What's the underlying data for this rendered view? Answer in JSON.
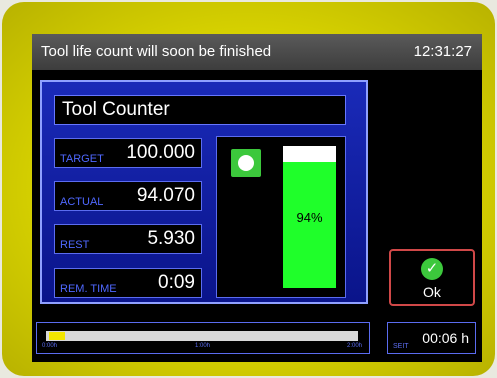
{
  "header": {
    "title": "Tool life count will soon be finished",
    "clock": "12:31:27"
  },
  "panel": {
    "title": "Tool Counter",
    "fields": [
      {
        "label": "TARGET",
        "value": "100.000"
      },
      {
        "label": "ACTUAL",
        "value": "94.070"
      },
      {
        "label": "REST",
        "value": "5.930"
      },
      {
        "label": "REM. TIME",
        "value": "0:09"
      }
    ],
    "gauge": {
      "percent_label": "94%",
      "fraction": 0.94,
      "icon": "tool-counter-icon"
    }
  },
  "ok_button": {
    "label": "Ok",
    "icon": "checkmark-icon"
  },
  "timeline": {
    "ticks": [
      "0:00h",
      "1:00h",
      "2:00h"
    ],
    "progress_fraction": 0.05
  },
  "seit": {
    "label": "SEIT",
    "value": "00:06 h"
  },
  "colors": {
    "bezel": "#e0dc00",
    "panel": "#1422a8",
    "gauge_fill": "#1fff2a",
    "accent_label": "#4f68ff"
  }
}
